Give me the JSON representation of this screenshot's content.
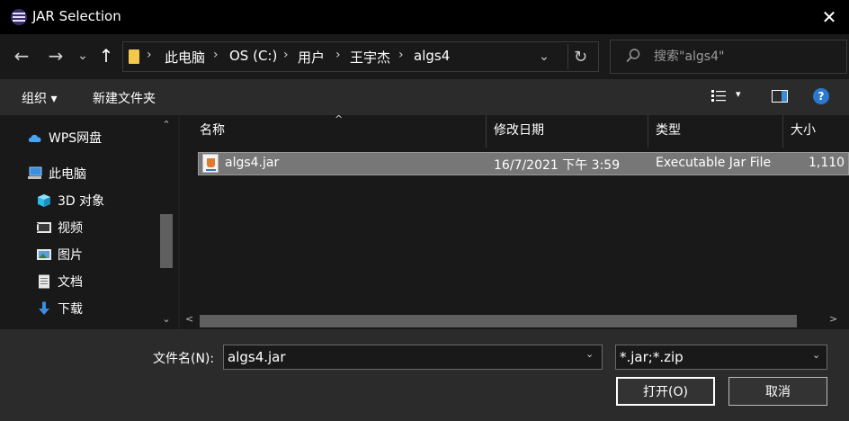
{
  "window": {
    "title": "JAR Selection",
    "close": "✕"
  },
  "nav": {
    "back": "←",
    "forward": "→",
    "recent": "⌄",
    "up": "↑",
    "breadcrumbs": [
      "此电脑",
      "OS (C:)",
      "用户",
      "王宇杰",
      "algs4"
    ],
    "separator": "›",
    "dropdown": "⌄",
    "refresh": "↻"
  },
  "search": {
    "placeholder": "搜索\"algs4\""
  },
  "toolbar": {
    "organize": "组织 ▾",
    "new_folder": "新建文件夹",
    "view_dropdown": "▾",
    "help": "?"
  },
  "sidebar": {
    "items": [
      {
        "label": "WPS网盘",
        "icon": "cloud-icon"
      },
      {
        "label": "此电脑",
        "icon": "computer-icon"
      },
      {
        "label": "3D 对象",
        "icon": "cube-3d-icon"
      },
      {
        "label": "视频",
        "icon": "video-icon"
      },
      {
        "label": "图片",
        "icon": "picture-icon"
      },
      {
        "label": "文档",
        "icon": "document-icon"
      },
      {
        "label": "下载",
        "icon": "download-icon"
      }
    ],
    "scroll_up": "⌃",
    "scroll_down": "⌄"
  },
  "filelist": {
    "columns": [
      "名称",
      "修改日期",
      "类型",
      "大小"
    ],
    "sort_arrow": "^",
    "rows": [
      {
        "name": "algs4.jar",
        "modified": "16/7/2021 下午 3:59",
        "type": "Executable Jar File",
        "size": "1,110"
      }
    ],
    "scroll_left": "<",
    "scroll_right": ">"
  },
  "bottom": {
    "filename_label": "文件名(N):",
    "filename_value": "algs4.jar",
    "dropdown": "⌄",
    "filetype_value": "*.jar;*.zip",
    "open_label": "打开(O)",
    "cancel_label": "取消"
  },
  "colors": {
    "background": "#202020",
    "titlebar": "#000000",
    "selection": "#777777",
    "accent": "#2a78d0",
    "folder": "#f3c84b"
  }
}
